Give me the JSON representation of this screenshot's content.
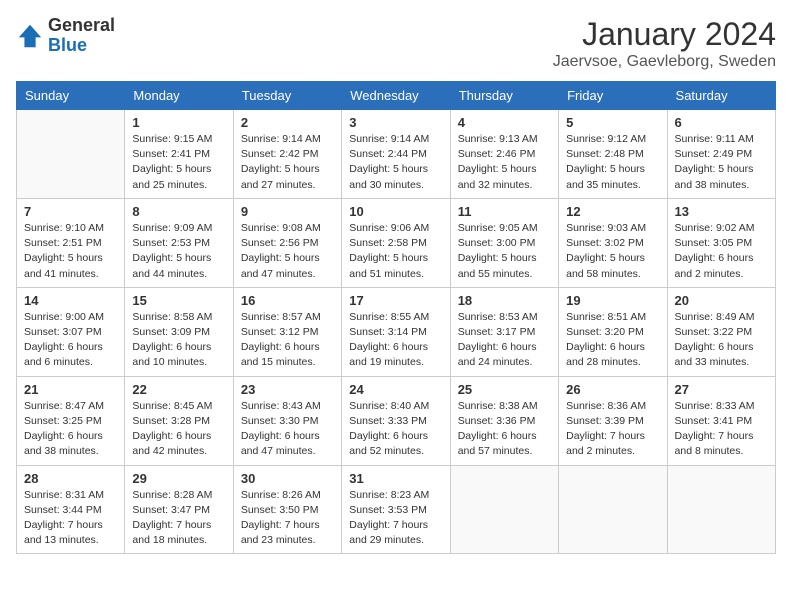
{
  "logo": {
    "general": "General",
    "blue": "Blue"
  },
  "title": "January 2024",
  "location": "Jaervsoe, Gaevleborg, Sweden",
  "days_of_week": [
    "Sunday",
    "Monday",
    "Tuesday",
    "Wednesday",
    "Thursday",
    "Friday",
    "Saturday"
  ],
  "weeks": [
    [
      {
        "day": "",
        "info": ""
      },
      {
        "day": "1",
        "info": "Sunrise: 9:15 AM\nSunset: 2:41 PM\nDaylight: 5 hours\nand 25 minutes."
      },
      {
        "day": "2",
        "info": "Sunrise: 9:14 AM\nSunset: 2:42 PM\nDaylight: 5 hours\nand 27 minutes."
      },
      {
        "day": "3",
        "info": "Sunrise: 9:14 AM\nSunset: 2:44 PM\nDaylight: 5 hours\nand 30 minutes."
      },
      {
        "day": "4",
        "info": "Sunrise: 9:13 AM\nSunset: 2:46 PM\nDaylight: 5 hours\nand 32 minutes."
      },
      {
        "day": "5",
        "info": "Sunrise: 9:12 AM\nSunset: 2:48 PM\nDaylight: 5 hours\nand 35 minutes."
      },
      {
        "day": "6",
        "info": "Sunrise: 9:11 AM\nSunset: 2:49 PM\nDaylight: 5 hours\nand 38 minutes."
      }
    ],
    [
      {
        "day": "7",
        "info": "Sunrise: 9:10 AM\nSunset: 2:51 PM\nDaylight: 5 hours\nand 41 minutes."
      },
      {
        "day": "8",
        "info": "Sunrise: 9:09 AM\nSunset: 2:53 PM\nDaylight: 5 hours\nand 44 minutes."
      },
      {
        "day": "9",
        "info": "Sunrise: 9:08 AM\nSunset: 2:56 PM\nDaylight: 5 hours\nand 47 minutes."
      },
      {
        "day": "10",
        "info": "Sunrise: 9:06 AM\nSunset: 2:58 PM\nDaylight: 5 hours\nand 51 minutes."
      },
      {
        "day": "11",
        "info": "Sunrise: 9:05 AM\nSunset: 3:00 PM\nDaylight: 5 hours\nand 55 minutes."
      },
      {
        "day": "12",
        "info": "Sunrise: 9:03 AM\nSunset: 3:02 PM\nDaylight: 5 hours\nand 58 minutes."
      },
      {
        "day": "13",
        "info": "Sunrise: 9:02 AM\nSunset: 3:05 PM\nDaylight: 6 hours\nand 2 minutes."
      }
    ],
    [
      {
        "day": "14",
        "info": "Sunrise: 9:00 AM\nSunset: 3:07 PM\nDaylight: 6 hours\nand 6 minutes."
      },
      {
        "day": "15",
        "info": "Sunrise: 8:58 AM\nSunset: 3:09 PM\nDaylight: 6 hours\nand 10 minutes."
      },
      {
        "day": "16",
        "info": "Sunrise: 8:57 AM\nSunset: 3:12 PM\nDaylight: 6 hours\nand 15 minutes."
      },
      {
        "day": "17",
        "info": "Sunrise: 8:55 AM\nSunset: 3:14 PM\nDaylight: 6 hours\nand 19 minutes."
      },
      {
        "day": "18",
        "info": "Sunrise: 8:53 AM\nSunset: 3:17 PM\nDaylight: 6 hours\nand 24 minutes."
      },
      {
        "day": "19",
        "info": "Sunrise: 8:51 AM\nSunset: 3:20 PM\nDaylight: 6 hours\nand 28 minutes."
      },
      {
        "day": "20",
        "info": "Sunrise: 8:49 AM\nSunset: 3:22 PM\nDaylight: 6 hours\nand 33 minutes."
      }
    ],
    [
      {
        "day": "21",
        "info": "Sunrise: 8:47 AM\nSunset: 3:25 PM\nDaylight: 6 hours\nand 38 minutes."
      },
      {
        "day": "22",
        "info": "Sunrise: 8:45 AM\nSunset: 3:28 PM\nDaylight: 6 hours\nand 42 minutes."
      },
      {
        "day": "23",
        "info": "Sunrise: 8:43 AM\nSunset: 3:30 PM\nDaylight: 6 hours\nand 47 minutes."
      },
      {
        "day": "24",
        "info": "Sunrise: 8:40 AM\nSunset: 3:33 PM\nDaylight: 6 hours\nand 52 minutes."
      },
      {
        "day": "25",
        "info": "Sunrise: 8:38 AM\nSunset: 3:36 PM\nDaylight: 6 hours\nand 57 minutes."
      },
      {
        "day": "26",
        "info": "Sunrise: 8:36 AM\nSunset: 3:39 PM\nDaylight: 7 hours\nand 2 minutes."
      },
      {
        "day": "27",
        "info": "Sunrise: 8:33 AM\nSunset: 3:41 PM\nDaylight: 7 hours\nand 8 minutes."
      }
    ],
    [
      {
        "day": "28",
        "info": "Sunrise: 8:31 AM\nSunset: 3:44 PM\nDaylight: 7 hours\nand 13 minutes."
      },
      {
        "day": "29",
        "info": "Sunrise: 8:28 AM\nSunset: 3:47 PM\nDaylight: 7 hours\nand 18 minutes."
      },
      {
        "day": "30",
        "info": "Sunrise: 8:26 AM\nSunset: 3:50 PM\nDaylight: 7 hours\nand 23 minutes."
      },
      {
        "day": "31",
        "info": "Sunrise: 8:23 AM\nSunset: 3:53 PM\nDaylight: 7 hours\nand 29 minutes."
      },
      {
        "day": "",
        "info": ""
      },
      {
        "day": "",
        "info": ""
      },
      {
        "day": "",
        "info": ""
      }
    ]
  ]
}
